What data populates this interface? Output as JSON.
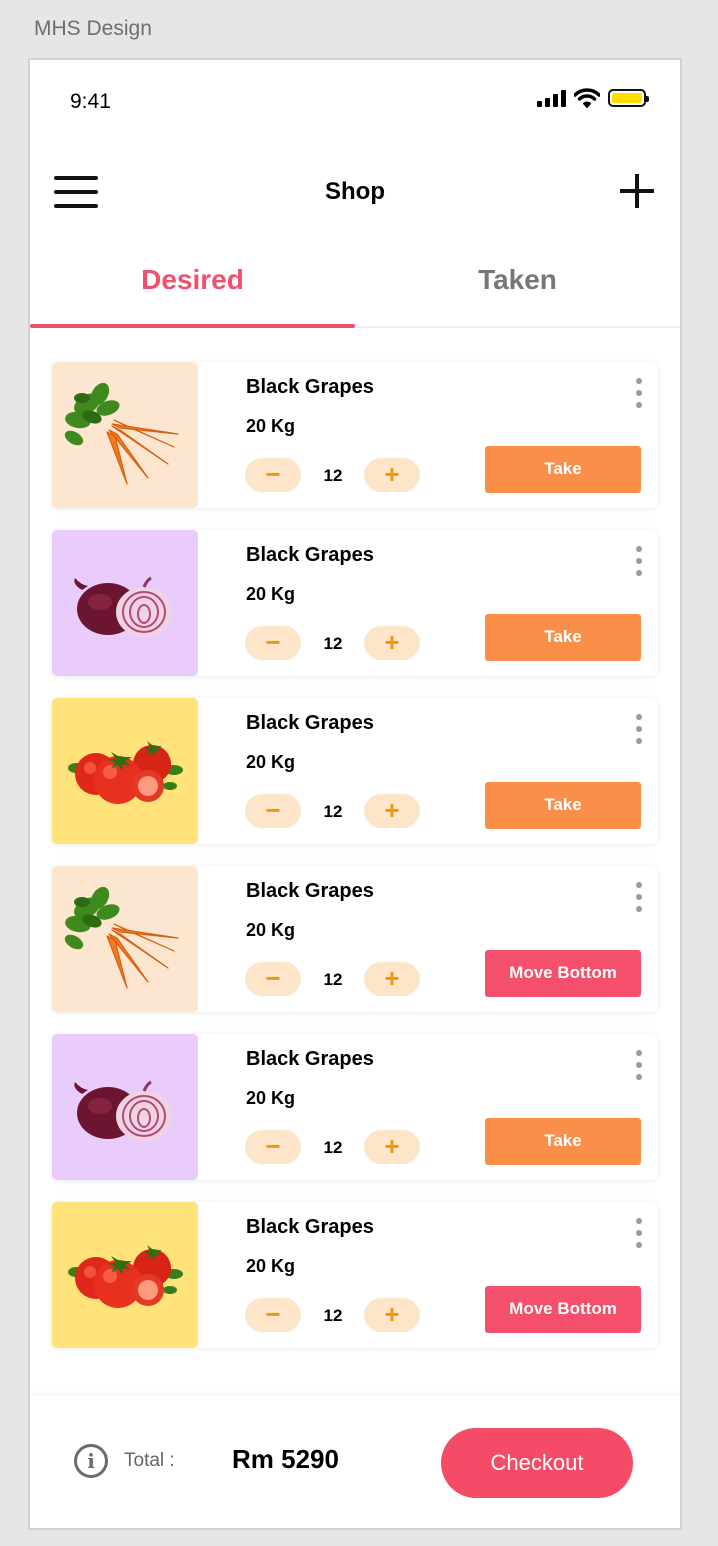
{
  "canvas_label": "MHS Design",
  "status_bar": {
    "time": "9:41"
  },
  "header": {
    "title": "Shop"
  },
  "tabs": [
    {
      "label": "Desired",
      "active": true
    },
    {
      "label": "Taken",
      "active": false
    }
  ],
  "items": [
    {
      "name": "Black Grapes",
      "weight": "20 Kg",
      "quantity": "12",
      "minus": "−",
      "plus": "+",
      "action": "Take",
      "action_type": "take",
      "image": "carrot",
      "bg": "#fce6cf"
    },
    {
      "name": "Black Grapes",
      "weight": "20 Kg",
      "quantity": "12",
      "minus": "−",
      "plus": "+",
      "action": "Take",
      "action_type": "take",
      "image": "onion",
      "bg": "#e9ccfc"
    },
    {
      "name": "Black Grapes",
      "weight": "20 Kg",
      "quantity": "12",
      "minus": "−",
      "plus": "+",
      "action": "Take",
      "action_type": "take",
      "image": "tomato",
      "bg": "#ffe27a"
    },
    {
      "name": "Black Grapes",
      "weight": "20 Kg",
      "quantity": "12",
      "minus": "−",
      "plus": "+",
      "action": "Move Bottom",
      "action_type": "move",
      "image": "carrot",
      "bg": "#fce6cf"
    },
    {
      "name": "Black Grapes",
      "weight": "20 Kg",
      "quantity": "12",
      "minus": "−",
      "plus": "+",
      "action": "Take",
      "action_type": "take",
      "image": "onion",
      "bg": "#e9ccfc"
    },
    {
      "name": "Black Grapes",
      "weight": "20 Kg",
      "quantity": "12",
      "minus": "−",
      "plus": "+",
      "action": "Move Bottom",
      "action_type": "move",
      "image": "tomato",
      "bg": "#ffe27a"
    }
  ],
  "footer": {
    "total_label": "Total :",
    "total_value": "Rm 5290",
    "checkout_label": "Checkout",
    "info_icon": "i"
  },
  "colors": {
    "accent": "#f0506e",
    "take_button": "#fa8f4a",
    "move_button": "#f4506b",
    "stepper_bg": "#fce5c9",
    "stepper_fg": "#f5940c"
  }
}
